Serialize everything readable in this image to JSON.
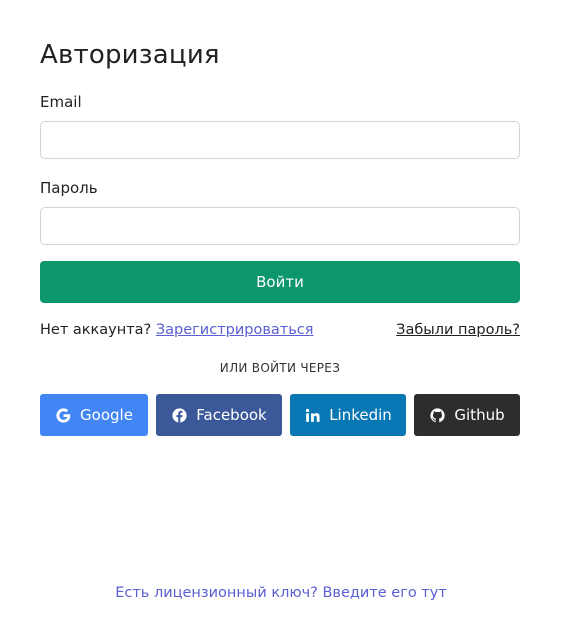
{
  "form": {
    "title": "Авторизация",
    "email_label": "Email",
    "email_value": "",
    "password_label": "Пароль",
    "password_value": "",
    "login_label": "Войти",
    "login_color": "#0b966b"
  },
  "links": {
    "no_account_text": "Нет аккаунта?",
    "register_label": "Зарегистрироваться",
    "forgot_label": "Забыли пароль?"
  },
  "social": {
    "divider_text": "ИЛИ ВОЙТИ ЧЕРЕЗ",
    "buttons": [
      {
        "label": "Google",
        "icon": "google-icon",
        "color": "#4285f4"
      },
      {
        "label": "Facebook",
        "icon": "facebook-icon",
        "color": "#3b5998"
      },
      {
        "label": "Linkedin",
        "icon": "linkedin-icon",
        "color": "#0a77b5"
      },
      {
        "label": "Github",
        "icon": "github-icon",
        "color": "#2d2d2d"
      }
    ]
  },
  "footer": {
    "license_link": "Есть лицензионный ключ? Введите его тут",
    "link_color": "#5a5fd1"
  }
}
